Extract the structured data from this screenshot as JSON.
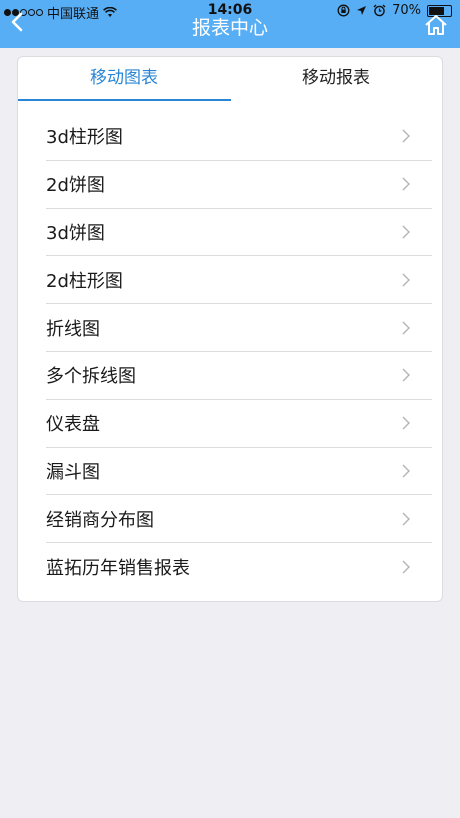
{
  "status_bar": {
    "carrier": "中国联通",
    "time": "14:06",
    "battery_text": "70%",
    "battery_level": 0.7
  },
  "nav": {
    "title": "报表中心",
    "back_icon": "chevron-left-icon",
    "home_icon": "home-icon"
  },
  "tabs": [
    {
      "label": "移动图表",
      "active": true
    },
    {
      "label": "移动报表",
      "active": false
    }
  ],
  "list_items": [
    {
      "label": "3d柱形图"
    },
    {
      "label": "2d饼图"
    },
    {
      "label": "3d饼图"
    },
    {
      "label": "2d柱形图"
    },
    {
      "label": "折线图"
    },
    {
      "label": "多个拆线图"
    },
    {
      "label": "仪表盘"
    },
    {
      "label": "漏斗图"
    },
    {
      "label": "经销商分布图"
    },
    {
      "label": "蓝拓历年销售报表"
    }
  ],
  "colors": {
    "header": "#57aef5",
    "active_tab": "#2a86d4",
    "background": "#eeeef3"
  }
}
